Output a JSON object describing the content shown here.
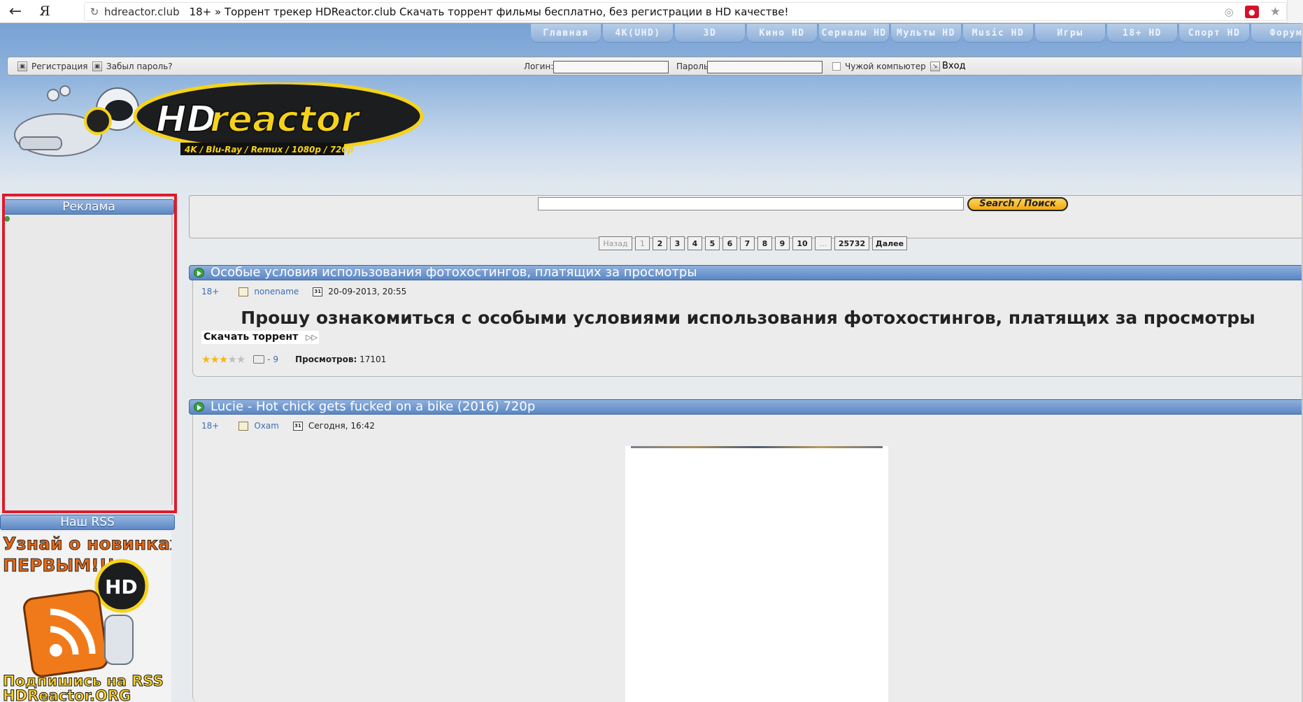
{
  "browser": {
    "domain": "hdreactor.club",
    "page_title": "18+ » Торрент трекер HDReactor.club Скачать торрент фильмы бесплатно, без регистрации в HD качестве!",
    "ya_label": "Я"
  },
  "nav": {
    "tabs": [
      "Главная",
      "4K(UHD)",
      "3D",
      "Кино HD",
      "Сериалы HD",
      "Мульты HD",
      "Music HD",
      "Игры",
      "18+ HD",
      "Спорт HD",
      "Форум"
    ]
  },
  "login": {
    "register": "Регистрация",
    "forgot": "Забыл пароль?",
    "login_label": "Логин:",
    "password_label": "Пароль",
    "foreign_pc": "Чужой компьютер",
    "enter": "Вход"
  },
  "logo": {
    "brand_hd": "HD",
    "brand_rest": "reactor",
    "formats": "4K / Blu-Ray / Remux / 1080p / 720p"
  },
  "sidebar": {
    "ad_title": "Реклама",
    "rss_title": "Наш RSS",
    "rss_banner_top": "Узнай о новинках",
    "rss_banner_top2": "ПЕРВЫМ!!!",
    "rss_banner_badge": "HD",
    "rss_banner_bottom": "Подпишись на RSS",
    "rss_banner_site": "HDReactor.ORG"
  },
  "search": {
    "button": "Search / Поиск",
    "value": ""
  },
  "pager": {
    "prev": "Назад",
    "pages": [
      "1",
      "2",
      "3",
      "4",
      "5",
      "6",
      "7",
      "8",
      "9",
      "10",
      "...",
      "25732"
    ],
    "next": "Далее"
  },
  "posts": [
    {
      "title": "Особые условия использования фотохостингов, платящих за просмотры",
      "category": "18+",
      "author": "nonename",
      "date": "20-09-2013, 20:55",
      "headline": "Прошу ознакомиться с особыми условиями использования фотохостингов, платящих за просмотры",
      "download": "Скачать торрент",
      "rating": 3,
      "rating_max": 5,
      "comments": "- 9",
      "views_label": "Просмотров:",
      "views": "17101"
    },
    {
      "title": "Lucie - Hot chick gets fucked on a bike (2016) 720p",
      "category": "18+",
      "author": "Oxam",
      "date": "Сегодня, 16:42"
    }
  ],
  "colors": {
    "accent_blue": "#5a86c3",
    "link_blue": "#3b6fb3",
    "highlight_red": "#e01a2b",
    "logo_yellow": "#f6d31b"
  }
}
